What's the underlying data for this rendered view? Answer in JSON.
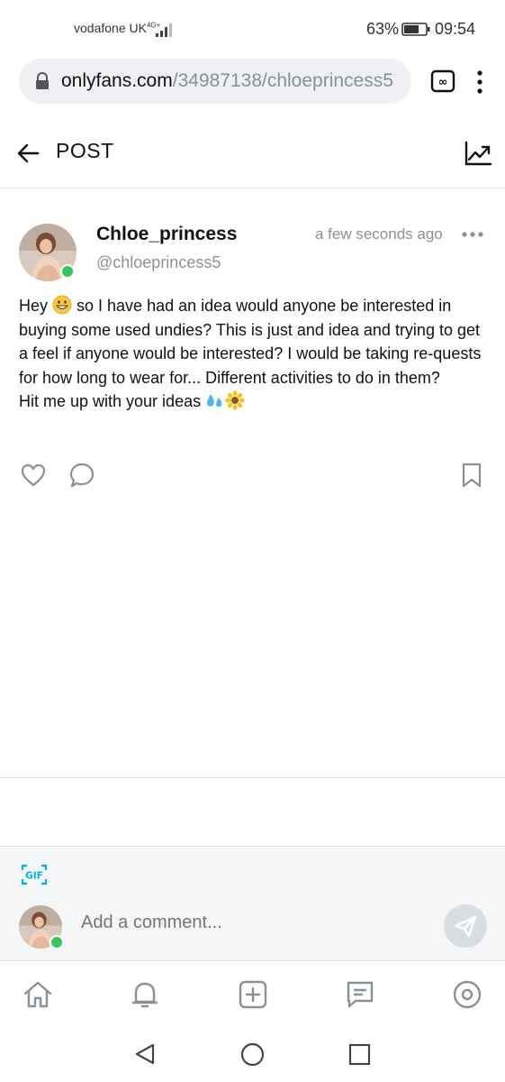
{
  "status_bar": {
    "carrier": "vodafone UK",
    "network": "4G+",
    "battery": "63%",
    "time": "09:54"
  },
  "browser": {
    "url_domain": "onlyfans.com",
    "url_path": "/34987138/chloeprincess5",
    "icons": [
      "lock-icon",
      "tab-switcher-icon",
      "menu-kebab-icon"
    ]
  },
  "header": {
    "title": "POST",
    "icons": [
      "back-arrow-icon",
      "statistics-icon"
    ]
  },
  "post": {
    "author_name": "Chloe_princess",
    "author_handle": "@chloeprincess5",
    "time": "a few seconds ago",
    "text_1": "Hey ",
    "text_2": " so I have had an idea would anyone be interested in buying some used undies? This is just and idea and trying to get a feel if anyone would be interested? I would be taking re-quests for how long to wear for... Different activities to do in them?\nHit me up with your ideas ",
    "emojis": [
      "grinning-face-emoji",
      "sweat-droplets-emoji",
      "sunflower-emoji"
    ],
    "actions": [
      "like-icon",
      "comment-icon",
      "bookmark-icon"
    ]
  },
  "comment_box": {
    "placeholder": "Add a comment...",
    "gif_label": "GIF"
  },
  "bottom_nav": {
    "items": [
      "home-icon",
      "notifications-icon",
      "add-post-icon",
      "messages-icon",
      "profile-icon"
    ]
  },
  "colors": {
    "accent": "#00aff0",
    "online": "#35c759",
    "muted_text": "#8a9097"
  }
}
